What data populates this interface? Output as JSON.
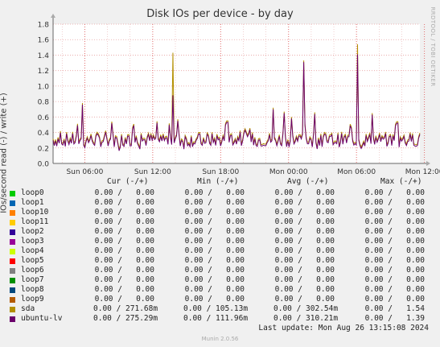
{
  "title": "Disk IOs per device - by day",
  "side_credit": "RRDTOOL / TOBI OETIKER",
  "chart_data": {
    "type": "line",
    "title": "Disk IOs per device - by day",
    "ylabel": "IOs/second read (-) / write (+)",
    "ylim": [
      0,
      1.8
    ],
    "yticks": [
      "0.0",
      "0.2",
      "0.4",
      "0.6",
      "0.8",
      "1.0",
      "1.2",
      "1.4",
      "1.6",
      "1.8"
    ],
    "xticks": [
      "Sun 06:00",
      "Sun 12:00",
      "Sun 18:00",
      "Mon 00:00",
      "Mon 06:00",
      "Mon 12:00"
    ],
    "x_start_hour": 3.2,
    "x_end_hour": 35.6,
    "xtick_hours": [
      6,
      12,
      18,
      24,
      30,
      36
    ],
    "grid": true,
    "baseline": 0.3,
    "spikes": [
      {
        "hour": 5.8,
        "value": 0.76
      },
      {
        "hour": 13.8,
        "value": 0.88,
        "sda": 1.43
      },
      {
        "hour": 14.2,
        "value": 0.55
      },
      {
        "hour": 22.6,
        "value": 0.7
      },
      {
        "hour": 23.6,
        "value": 0.65
      },
      {
        "hour": 25.3,
        "value": 1.31
      },
      {
        "hour": 26.3,
        "value": 0.64
      },
      {
        "hour": 30.1,
        "value": 1.41,
        "sda": 1.54
      },
      {
        "hour": 31.4,
        "value": 0.63
      },
      {
        "hour": 33.6,
        "value": 0.52
      },
      {
        "hour": 18.6,
        "value": 0.53
      },
      {
        "hour": 8.4,
        "value": 0.52
      },
      {
        "hour": 10.3,
        "value": 0.49
      }
    ],
    "series": [
      {
        "name": "loop0",
        "color": "#00cc00"
      },
      {
        "name": "loop1",
        "color": "#0066b3"
      },
      {
        "name": "loop10",
        "color": "#ff8000"
      },
      {
        "name": "loop11",
        "color": "#ffcc00"
      },
      {
        "name": "loop2",
        "color": "#330099"
      },
      {
        "name": "loop3",
        "color": "#990099"
      },
      {
        "name": "loop4",
        "color": "#ccff00"
      },
      {
        "name": "loop5",
        "color": "#ff0000"
      },
      {
        "name": "loop6",
        "color": "#808080"
      },
      {
        "name": "loop7",
        "color": "#008f00"
      },
      {
        "name": "loop8",
        "color": "#00487d"
      },
      {
        "name": "loop9",
        "color": "#b35a00"
      },
      {
        "name": "sda",
        "color": "#b38f00"
      },
      {
        "name": "ubuntu-lv",
        "color": "#6b006b"
      }
    ]
  },
  "legend": {
    "headers": {
      "cur": "Cur (-/+)",
      "min": "Min (-/+)",
      "avg": "Avg (-/+)",
      "max": "Max (-/+)"
    },
    "rows": [
      {
        "name": "loop0",
        "color": "#00cc00",
        "cur": "0.00 /   0.00",
        "min": "0.00 /   0.00",
        "avg": "0.00 /   0.00",
        "max": "0.00 /   0.00"
      },
      {
        "name": "loop1",
        "color": "#0066b3",
        "cur": "0.00 /   0.00",
        "min": "0.00 /   0.00",
        "avg": "0.00 /   0.00",
        "max": "0.00 /   0.00"
      },
      {
        "name": "loop10",
        "color": "#ff8000",
        "cur": "0.00 /   0.00",
        "min": "0.00 /   0.00",
        "avg": "0.00 /   0.00",
        "max": "0.00 /   0.00"
      },
      {
        "name": "loop11",
        "color": "#ffcc00",
        "cur": "0.00 /   0.00",
        "min": "0.00 /   0.00",
        "avg": "0.00 /   0.00",
        "max": "0.00 /   0.00"
      },
      {
        "name": "loop2",
        "color": "#330099",
        "cur": "0.00 /   0.00",
        "min": "0.00 /   0.00",
        "avg": "0.00 /   0.00",
        "max": "0.00 /   0.00"
      },
      {
        "name": "loop3",
        "color": "#990099",
        "cur": "0.00 /   0.00",
        "min": "0.00 /   0.00",
        "avg": "0.00 /   0.00",
        "max": "0.00 /   0.00"
      },
      {
        "name": "loop4",
        "color": "#ccff00",
        "cur": "0.00 /   0.00",
        "min": "0.00 /   0.00",
        "avg": "0.00 /   0.00",
        "max": "0.00 /   0.00"
      },
      {
        "name": "loop5",
        "color": "#ff0000",
        "cur": "0.00 /   0.00",
        "min": "0.00 /   0.00",
        "avg": "0.00 /   0.00",
        "max": "0.00 /   0.00"
      },
      {
        "name": "loop6",
        "color": "#808080",
        "cur": "0.00 /   0.00",
        "min": "0.00 /   0.00",
        "avg": "0.00 /   0.00",
        "max": "0.00 /   0.00"
      },
      {
        "name": "loop7",
        "color": "#008f00",
        "cur": "0.00 /   0.00",
        "min": "0.00 /   0.00",
        "avg": "0.00 /   0.00",
        "max": "0.00 /   0.00"
      },
      {
        "name": "loop8",
        "color": "#00487d",
        "cur": "0.00 /   0.00",
        "min": "0.00 /   0.00",
        "avg": "0.00 /   0.00",
        "max": "0.00 /   0.00"
      },
      {
        "name": "loop9",
        "color": "#b35a00",
        "cur": "0.00 /   0.00",
        "min": "0.00 /   0.00",
        "avg": "0.00 /   0.00",
        "max": "0.00 /   0.00"
      },
      {
        "name": "sda",
        "color": "#b38f00",
        "cur": "0.00 / 271.68m",
        "min": "0.00 / 105.13m",
        "avg": "0.00 / 302.54m",
        "max": "0.00 /   1.54"
      },
      {
        "name": "ubuntu-lv",
        "color": "#6b006b",
        "cur": "0.00 / 275.29m",
        "min": "0.00 / 111.96m",
        "avg": "0.00 / 310.21m",
        "max": "0.00 /   1.39"
      }
    ]
  },
  "last_update": "Last update: Mon Aug 26 13:15:08 2024",
  "munin_version": "Munin 2.0.56"
}
